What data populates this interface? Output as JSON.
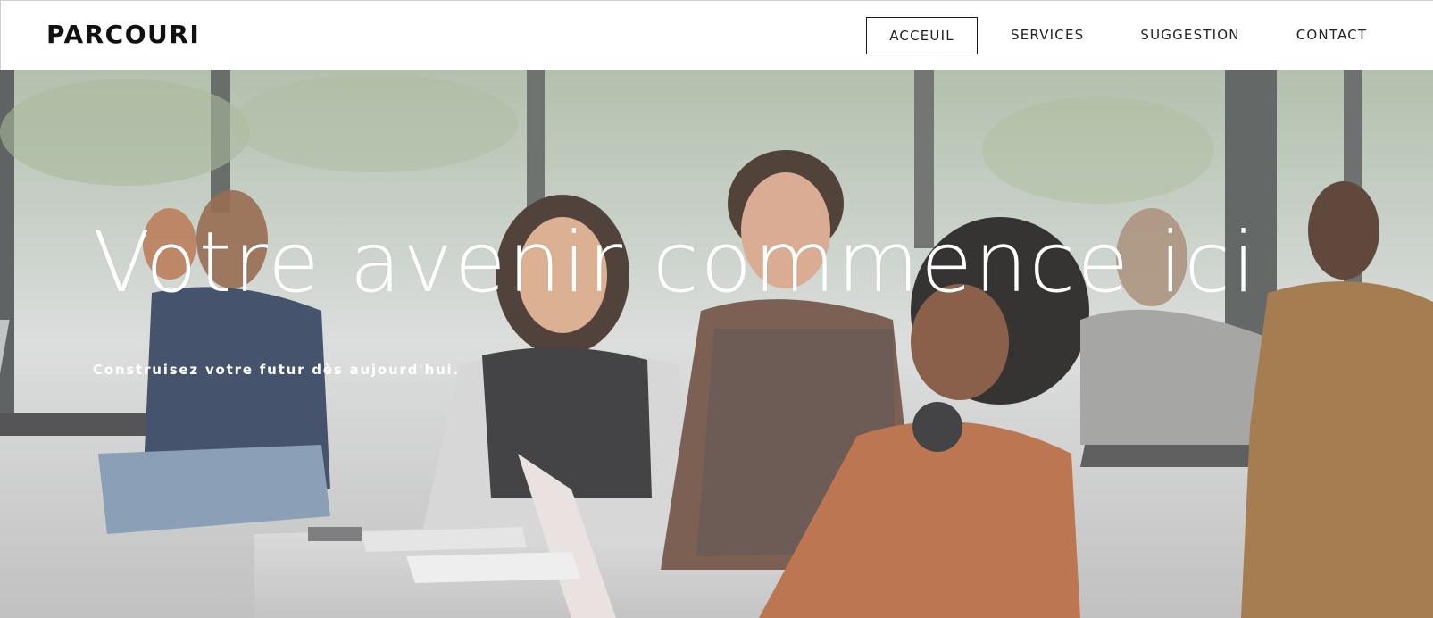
{
  "header": {
    "brand": "PARCOURI",
    "nav": [
      {
        "label": "ACCEUIL",
        "active": true
      },
      {
        "label": "SERVICES",
        "active": false
      },
      {
        "label": "SUGGESTION",
        "active": false
      },
      {
        "label": "CONTACT",
        "active": false
      }
    ]
  },
  "hero": {
    "title": "Votre avenir commence ici",
    "subtitle": "Construisez votre futur dès aujourd'hui.",
    "background_image": "students-working-together-at-table-photo"
  },
  "colors": {
    "header_bg": "#ffffff",
    "text_dark": "#111111",
    "hero_text": "#ffffff"
  }
}
